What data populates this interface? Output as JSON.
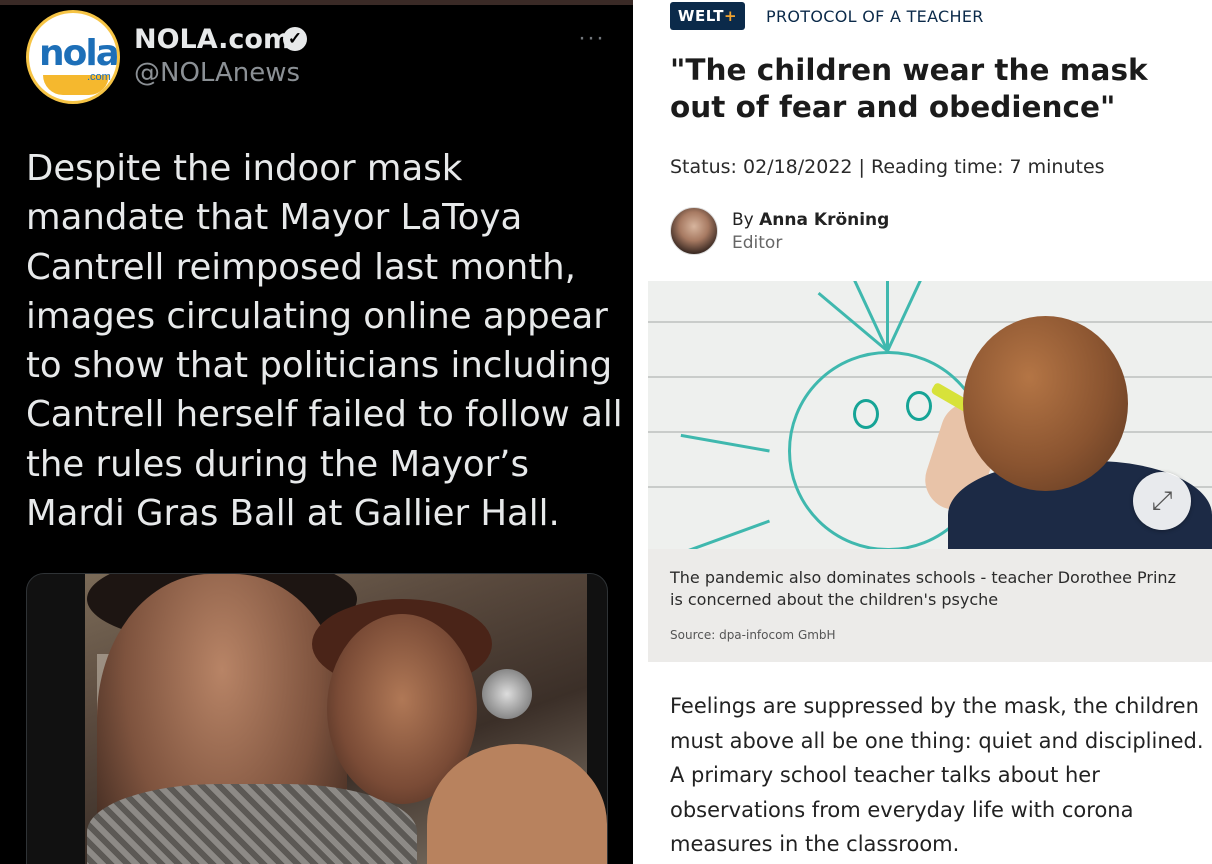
{
  "tweet": {
    "avatar_word": "nola",
    "avatar_com": ".com",
    "name": "NOLA.com",
    "handle": "@NOLAnews",
    "more": "···",
    "text": "Despite the indoor mask mandate that Mayor LaToya Cantrell reimposed last month, images circulating online appear to show that politicians including Cantrell herself failed to follow all the rules during the Mayor’s Mardi Gras Ball at Gallier Hall."
  },
  "article": {
    "logo": "WELT",
    "logo_plus": "+",
    "kicker": "PROTOCOL OF A TEACHER",
    "headline": "\"The children wear the mask out of fear and obedience\"",
    "meta": "Status: 02/18/2022  | Reading time: 7 minutes",
    "by_prefix": "By ",
    "author": "Anna Kröning",
    "role": "Editor",
    "caption": "The pandemic also dominates schools - teacher Dorothee Prinz is concerned about the children's psyche",
    "source": "Source: dpa-infocom GmbH",
    "lede": "Feelings are suppressed by the mask, the children must above all be one thing: quiet and disciplined. A primary school teacher talks about her observations from everyday life with corona measures in the classroom."
  }
}
